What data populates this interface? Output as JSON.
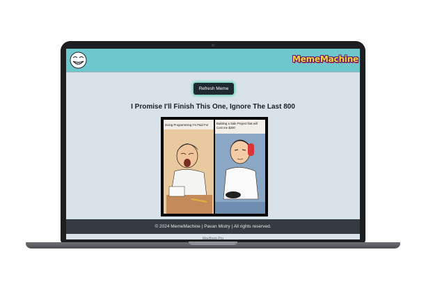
{
  "header": {
    "brand": "MemeMachine",
    "logo_icon": "trollface-icon"
  },
  "main": {
    "refresh_label": "Refresh Meme",
    "meme_title": "I Promise I'll Finish This One, Ignore The Last 800",
    "meme": {
      "left_caption": "Doing Programming I'm Paid For",
      "right_caption": "Building a Side Project that will Cost me $200"
    }
  },
  "footer": {
    "copyright": "© 2024 MemeMachine | Pavan Mistry | All rights reserved."
  },
  "device": {
    "label": "MacBook Pro"
  },
  "colors": {
    "header_bg": "#6ec7cc",
    "page_bg": "#d9e2e8",
    "footer_bg": "#353b41",
    "button_bg": "#1f2a30",
    "button_glow": "#3fd0a8",
    "brand_text": "#ffd23a"
  }
}
